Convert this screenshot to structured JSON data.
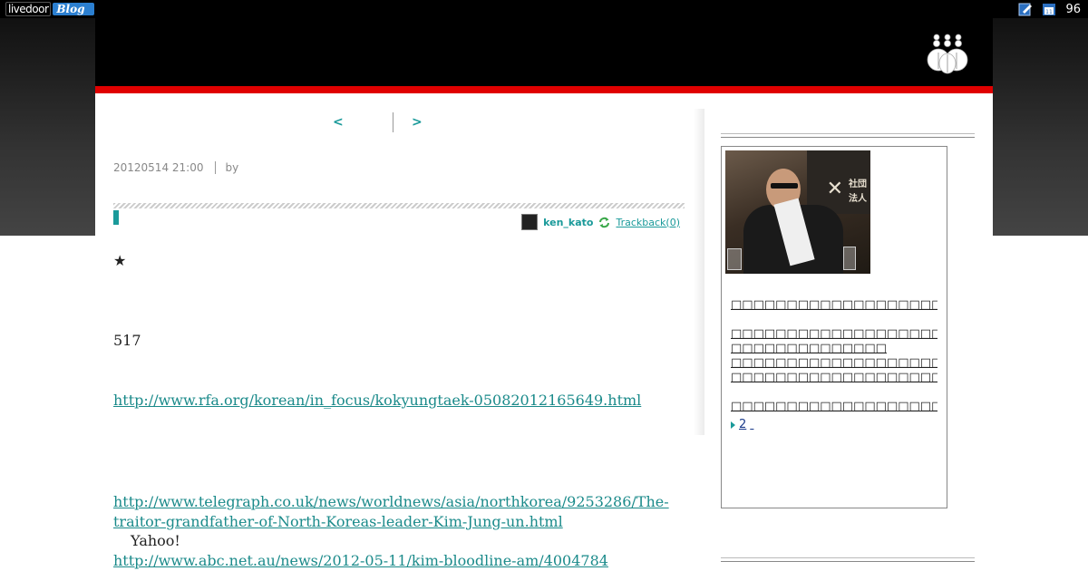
{
  "topbar": {
    "logo_text": "livedoor",
    "logo_badge": "Blog",
    "count": "96"
  },
  "nav": {
    "prev": "<",
    "next": ">"
  },
  "post": {
    "date": "20120514 21:00",
    "by_label": "by",
    "author": "ken_kato",
    "trackback": "Trackback(0)"
  },
  "article": {
    "star": "★",
    "number": "517",
    "link1": "http://www.rfa.org/korean/in_focus/kokyungtaek-05082012165649.html",
    "link2": "http://www.telegraph.co.uk/news/worldnews/asia/northkorea/9253286/The-traitor-grandfather-of-North-Koreas-leader-Kim-Jung-un.html",
    "yahoo": "Yahoo!",
    "link3": "http://www.abc.net.au/news/2012-05-11/kim-bloodline-am/4004784"
  },
  "sidebar": {
    "profile_more": "2"
  }
}
